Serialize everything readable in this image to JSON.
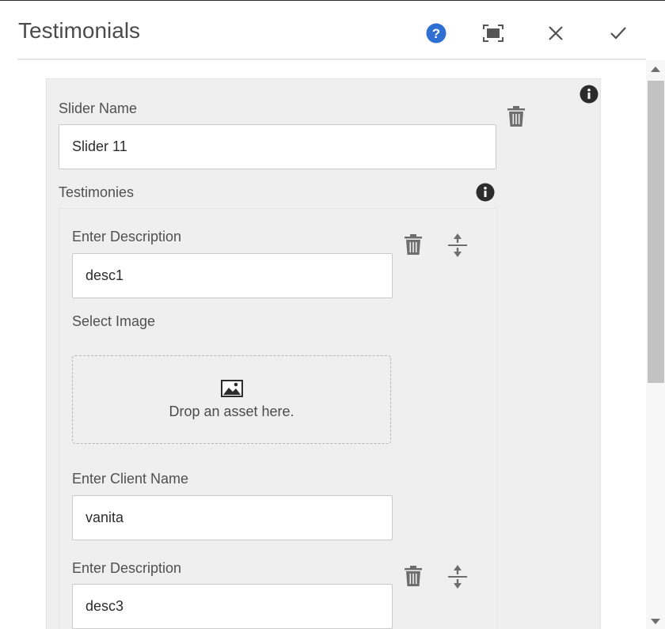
{
  "dialog": {
    "title": "Testimonials",
    "help_icon": "help-icon",
    "fullscreen_icon": "fullscreen-icon",
    "close_icon": "close-icon",
    "confirm_icon": "checkmark-icon"
  },
  "slider": {
    "name_label": "Slider Name",
    "name_value": "Slider 11",
    "testimonies_label": "Testimonies"
  },
  "testimonies": [
    {
      "description_label": "Enter Description",
      "description_value": "desc1",
      "image_label": "Select Image",
      "dropzone_text": "Drop an asset here.",
      "client_label": "Enter Client Name",
      "client_value": "vanita"
    },
    {
      "description_label": "Enter Description",
      "description_value": "desc3"
    }
  ],
  "colors": {
    "help_blue": "#2d6fd3",
    "panel_gray": "#efefef",
    "icon_gray": "#6e6e6e"
  }
}
